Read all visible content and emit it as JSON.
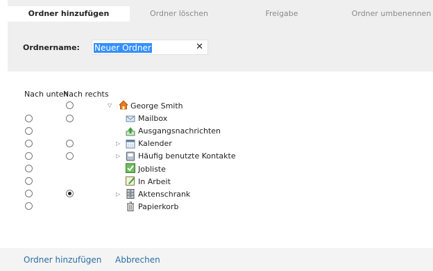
{
  "tabs": {
    "add": "Ordner hinzufügen",
    "delete": "Ordner löschen",
    "share": "Freigabe",
    "rename": "Ordner umbenennen"
  },
  "form": {
    "name_label": "Ordnername:",
    "name_value": "Neuer Ordner",
    "clear_symbol": "✕"
  },
  "columns": {
    "down": "Nach unten",
    "right": "Nach rechts"
  },
  "tree": {
    "root": {
      "label": "George Smith",
      "icon": "home-icon",
      "expander": "▽"
    },
    "items": [
      {
        "label": "Mailbox",
        "icon": "mailbox-icon"
      },
      {
        "label": "Ausgangsnachrichten",
        "icon": "outbox-icon"
      },
      {
        "label": "Kalender",
        "icon": "calendar-icon",
        "expander": "▷"
      },
      {
        "label": "Häufig benutzte Kontakte",
        "icon": "contacts-icon",
        "expander": "▷"
      },
      {
        "label": "Jobliste",
        "icon": "tasklist-icon"
      },
      {
        "label": "In Arbeit",
        "icon": "in-progress-icon"
      },
      {
        "label": "Aktenschrank",
        "icon": "cabinet-icon",
        "expander": "▷",
        "selected_right": true
      },
      {
        "label": "Papierkorb",
        "icon": "trash-icon"
      }
    ]
  },
  "footer": {
    "add": "Ordner hinzufügen",
    "cancel": "Abbrechen"
  },
  "colors": {
    "panel_bg": "#efefef",
    "selection": "#3390ff",
    "link": "#2a6ea0",
    "home_orange": "#e8791c"
  }
}
